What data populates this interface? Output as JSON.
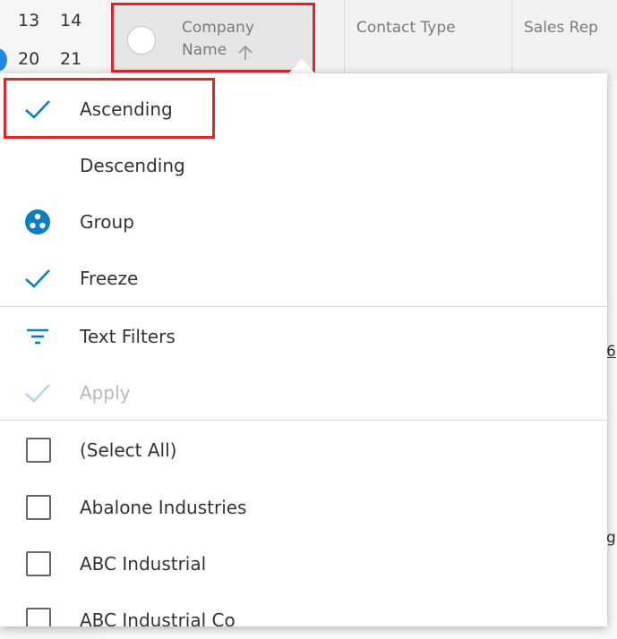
{
  "calendar": {
    "days": [
      "13",
      "14",
      "20",
      "21"
    ]
  },
  "grid": {
    "columns": [
      {
        "label_line1": "Company",
        "label_line2": "Name",
        "sorted": "ascending"
      },
      {
        "label": "Contact Type"
      },
      {
        "label": "Sales Rep"
      }
    ],
    "peek_texts": [
      "6",
      "g"
    ]
  },
  "menu": {
    "sort_items": [
      {
        "label": "Ascending",
        "icon": "checkmark-icon",
        "checked": true
      },
      {
        "label": "Descending",
        "icon": "",
        "checked": false
      },
      {
        "label": "Group",
        "icon": "group-icon"
      },
      {
        "label": "Freeze",
        "icon": "checkmark-icon",
        "checked": true
      }
    ],
    "filter_items": [
      {
        "label": "Text Filters",
        "icon": "filter-icon"
      },
      {
        "label": "Apply",
        "icon": "checkmark-icon",
        "disabled": true
      }
    ],
    "values": [
      {
        "label": "(Select All)",
        "checked": false
      },
      {
        "label": "Abalone Industries",
        "checked": false
      },
      {
        "label": "ABC Industrial",
        "checked": false
      },
      {
        "label": "ABC Industrial Co",
        "checked": false
      }
    ]
  },
  "colors": {
    "accent": "#0a7fc4",
    "highlight": "#e0252a",
    "disabled": "#b9b9b9"
  }
}
